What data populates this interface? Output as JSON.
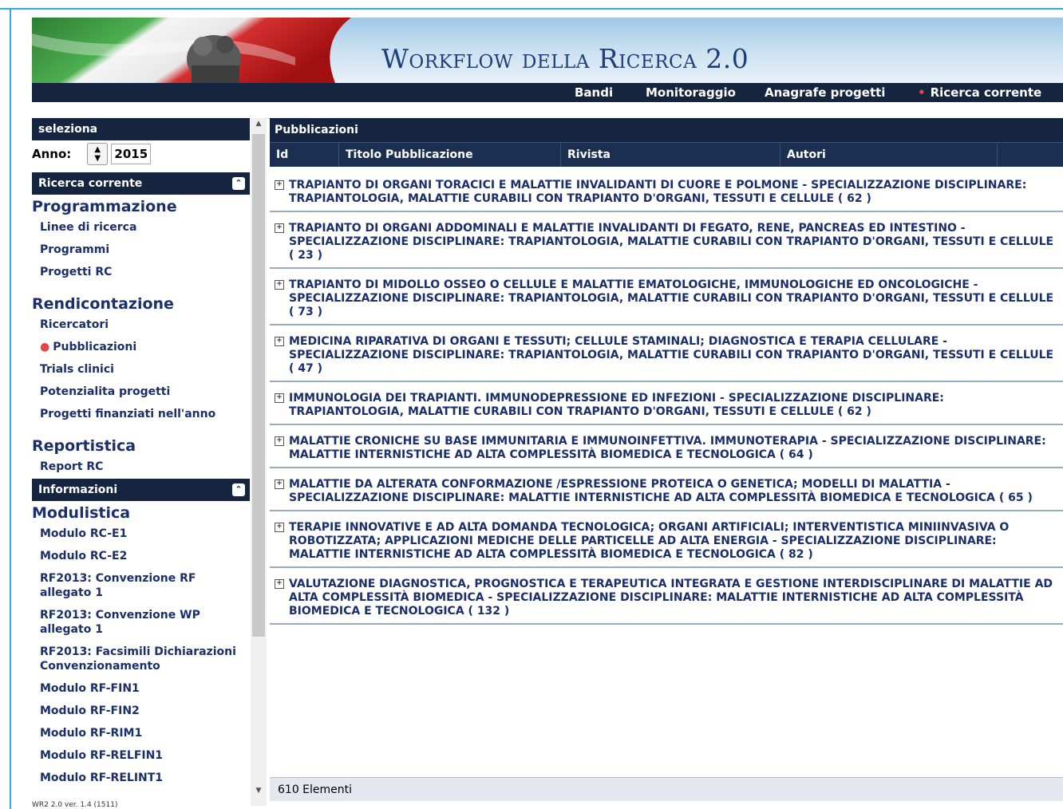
{
  "header": {
    "title": "Workflow della Ricerca 2.0",
    "nav": [
      "Bandi",
      "Monitoraggio",
      "Anagrafe progetti",
      "Ricerca corrente"
    ],
    "active_nav_index": 3
  },
  "sidebar": {
    "select_header": "seleziona",
    "anno_label": "Anno:",
    "anno_value": "2015",
    "ricerca_header": "Ricerca corrente",
    "sections": [
      {
        "title": "Programmazione",
        "links": [
          "Linee di ricerca",
          "Programmi",
          "Progetti RC"
        ]
      },
      {
        "title": "Rendicontazione",
        "links": [
          "Ricercatori",
          "Pubblicazioni",
          "Trials clinici",
          "Potenzialita progetti",
          "Progetti finanziati nell'anno"
        ]
      },
      {
        "title": "Reportistica",
        "links": [
          "Report RC"
        ]
      }
    ],
    "info_header": "Informazioni",
    "modulistica_title": "Modulistica",
    "modulistica_links": [
      "Modulo RC-E1",
      "Modulo RC-E2",
      "RF2013: Convenzione RF allegato 1",
      "RF2013: Convenzione WP allegato 1",
      "RF2013: Facsimili Dichiarazioni Convenzionamento",
      "Modulo RF-FIN1",
      "Modulo RF-FIN2",
      "Modulo RF-RIM1",
      "Modulo RF-RELFIN1",
      "Modulo RF-RELINT1"
    ],
    "version": "WR2 2.0 ver. 1.4 (1511)"
  },
  "grid": {
    "title": "Pubblicazioni",
    "columns": [
      "Id",
      "Titolo Pubblicazione",
      "Rivista",
      "Autori"
    ],
    "groups": [
      "TRAPIANTO DI ORGANI TORACICI E MALATTIE INVALIDANTI DI CUORE E POLMONE - SPECIALIZZAZIONE DISCIPLINARE: TRAPIANTOLOGIA, MALATTIE CURABILI CON TRAPIANTO D'ORGANI, TESSUTI E CELLULE ( 62 )",
      "TRAPIANTO DI ORGANI ADDOMINALI E MALATTIE INVALIDANTI DI FEGATO, RENE, PANCREAS ED INTESTINO - SPECIALIZZAZIONE DISCIPLINARE: TRAPIANTOLOGIA, MALATTIE CURABILI CON TRAPIANTO D'ORGANI, TESSUTI E CELLULE ( 23 )",
      "TRAPIANTO DI MIDOLLO OSSEO O CELLULE E MALATTIE EMATOLOGICHE, IMMUNOLOGICHE ED ONCOLOGICHE - SPECIALIZZAZIONE DISCIPLINARE: TRAPIANTOLOGIA, MALATTIE CURABILI CON TRAPIANTO D'ORGANI, TESSUTI E CELLULE ( 73 )",
      "MEDICINA RIPARATIVA DI ORGANI E TESSUTI; CELLULE STAMINALI; DIAGNOSTICA E TERAPIA CELLULARE - SPECIALIZZAZIONE DISCIPLINARE: TRAPIANTOLOGIA, MALATTIE CURABILI CON TRAPIANTO D'ORGANI, TESSUTI E CELLULE ( 47 )",
      "IMMUNOLOGIA DEI TRAPIANTI. IMMUNODEPRESSIONE ED INFEZIONI - SPECIALIZZAZIONE DISCIPLINARE: TRAPIANTOLOGIA, MALATTIE CURABILI CON TRAPIANTO D'ORGANI, TESSUTI E CELLULE ( 62 )",
      "MALATTIE CRONICHE SU BASE IMMUNITARIA E IMMUNOINFETTIVA. IMMUNOTERAPIA - SPECIALIZZAZIONE DISCIPLINARE: MALATTIE INTERNISTICHE AD ALTA COMPLESSITÀ BIOMEDICA E TECNOLOGICA ( 64 )",
      "MALATTIE DA ALTERATA CONFORMAZIONE /ESPRESSIONE PROTEICA O GENETICA; MODELLI DI MALATTIA - SPECIALIZZAZIONE DISCIPLINARE: MALATTIE INTERNISTICHE AD ALTA COMPLESSITÀ BIOMEDICA E TECNOLOGICA ( 65 )",
      "TERAPIE INNOVATIVE E AD ALTA DOMANDA TECNOLOGICA; ORGANI ARTIFICIALI; INTERVENTISTICA MINIINVASIVA O ROBOTIZZATA; APPLICAZIONI MEDICHE DELLE PARTICELLE AD ALTA ENERGIA - SPECIALIZZAZIONE DISCIPLINARE: MALATTIE INTERNISTICHE AD ALTA COMPLESSITÀ BIOMEDICA E TECNOLOGICA ( 82 )",
      "VALUTAZIONE DIAGNOSTICA, PROGNOSTICA E TERAPEUTICA INTEGRATA E GESTIONE INTERDISCIPLINARE DI MALATTIE AD ALTA COMPLESSITÀ BIOMEDICA - SPECIALIZZAZIONE DISCIPLINARE: MALATTIE INTERNISTICHE AD ALTA COMPLESSITÀ BIOMEDICA E TECNOLOGICA ( 132 )"
    ],
    "footer": "610 Elementi"
  },
  "colors": {
    "dark_nav": "#15253f",
    "accent_red": "#e04646",
    "link_blue": "#1b2f6b"
  }
}
